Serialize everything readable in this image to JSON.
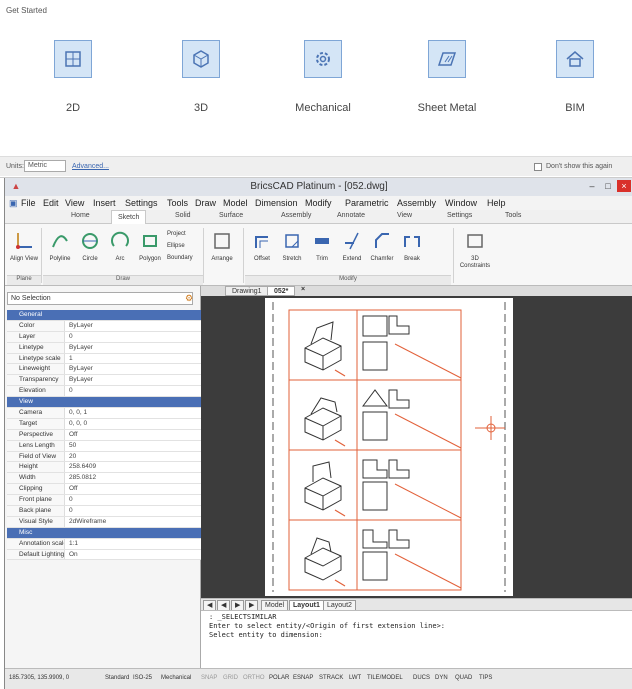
{
  "get_started": {
    "title": "Get Started",
    "cards": [
      {
        "label": "2D",
        "icon": "2d-grid-icon"
      },
      {
        "label": "3D",
        "icon": "3d-cube-icon"
      },
      {
        "label": "Mechanical",
        "icon": "gear-icon"
      },
      {
        "label": "Sheet Metal",
        "icon": "sheet-metal-icon"
      },
      {
        "label": "BIM",
        "icon": "house-icon"
      }
    ],
    "bottom": {
      "units_label": "Units:",
      "units_value": "Metric",
      "advanced": "Advanced...",
      "dont_show": "Don't show this again"
    }
  },
  "window": {
    "title": "BricsCAD Platinum - [052.dwg]"
  },
  "menu": [
    "File",
    "Edit",
    "View",
    "Insert",
    "Settings",
    "Tools",
    "Draw",
    "Model",
    "Dimension",
    "Modify",
    "Parametric",
    "Assembly",
    "Window",
    "Help"
  ],
  "ribbon_tabs": [
    "Home",
    "Sketch",
    "Solid",
    "Surface",
    "Assembly",
    "Annotate",
    "View",
    "Settings",
    "Tools"
  ],
  "ribbon": {
    "tools": [
      {
        "label": "Align View"
      },
      {
        "label": "Polyline"
      },
      {
        "label": "Circle"
      },
      {
        "label": "Arc"
      },
      {
        "label": "Polygon"
      },
      {
        "label": "Project"
      },
      {
        "label": "Ellipse"
      },
      {
        "label": "Boundary"
      },
      {
        "label": "Arrange"
      },
      {
        "label": "Offset"
      },
      {
        "label": "Stretch"
      },
      {
        "label": "Trim"
      },
      {
        "label": "Extend"
      },
      {
        "label": "Chamfer"
      },
      {
        "label": "Break"
      },
      {
        "label": "3D Constraints"
      }
    ],
    "groups": [
      "Plane",
      "Draw",
      "Modify"
    ]
  },
  "properties": {
    "selection": "No Selection",
    "rows": [
      {
        "k": "General",
        "v": "",
        "cat": true
      },
      {
        "k": "Color",
        "v": "ByLayer"
      },
      {
        "k": "Layer",
        "v": "0"
      },
      {
        "k": "Linetype",
        "v": "ByLayer"
      },
      {
        "k": "Linetype scale",
        "v": "1"
      },
      {
        "k": "Lineweight",
        "v": "ByLayer"
      },
      {
        "k": "Transparency",
        "v": "ByLayer"
      },
      {
        "k": "Elevation",
        "v": "0"
      },
      {
        "k": "View",
        "v": "",
        "cat": true
      },
      {
        "k": "Camera",
        "v": "0, 0, 1"
      },
      {
        "k": "Target",
        "v": "0, 0, 0"
      },
      {
        "k": "Perspective",
        "v": "Off"
      },
      {
        "k": "Lens Length",
        "v": "50"
      },
      {
        "k": "Field of View",
        "v": "20"
      },
      {
        "k": "Height",
        "v": "258.6409"
      },
      {
        "k": "Width",
        "v": "285.0812"
      },
      {
        "k": "Clipping",
        "v": "Off"
      },
      {
        "k": "Front plane",
        "v": "0"
      },
      {
        "k": "Back plane",
        "v": "0"
      },
      {
        "k": "Visual Style",
        "v": "2dWireframe"
      },
      {
        "k": "Misc",
        "v": "",
        "cat": true
      },
      {
        "k": "Annotation scale",
        "v": "1:1"
      },
      {
        "k": "Default Lighting",
        "v": "On"
      }
    ]
  },
  "drawing_tabs": [
    "Drawing1",
    "052*"
  ],
  "layout_tabs": [
    "Model",
    "Layout1",
    "Layout2"
  ],
  "command_lines": [
    ": _SELECTSIMILAR",
    "Enter to select entity/<Origin of first extension line>:",
    "Select entity to dimension:"
  ],
  "status": {
    "coords": "185.7305, 135.9909, 0",
    "items": [
      "Standard",
      "ISO-25",
      "Mechanical",
      "SNAP",
      "GRID",
      "ORTHO",
      "POLAR",
      "ESNAP",
      "STRACK",
      "LWT",
      "TILE/MODEL",
      "DUCS",
      "DYN",
      "QUAD",
      "TIPS"
    ]
  },
  "colors": {
    "accent": "#4a6fb5",
    "drawing_bg": "#3c3c3c",
    "sketch": "#e2613a"
  }
}
